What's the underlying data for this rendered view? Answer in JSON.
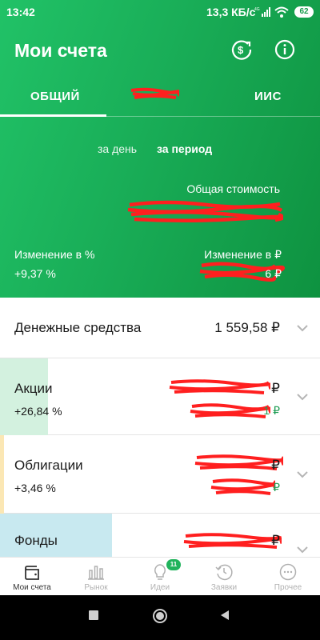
{
  "status": {
    "time": "13:42",
    "speed": "13,3 КБ/с",
    "network": "4G",
    "battery": "62"
  },
  "header": {
    "title": "Мои счета",
    "icons": [
      "currency-exchange-icon",
      "info-icon"
    ]
  },
  "tabs": [
    {
      "label": "ОБЩИЙ",
      "active": true
    },
    {
      "label": "",
      "redacted": true
    },
    {
      "label": "ИИС",
      "active": false
    }
  ],
  "period": {
    "day": "за день",
    "period": "за период",
    "selected": "за период"
  },
  "summary": {
    "total_label": "Общая стоимость",
    "change_pct_label": "Изменение в  %",
    "change_rub_label": "Изменение в ₽",
    "change_pct": "+9,37  %",
    "change_rub_tail": "6 ₽"
  },
  "assets": [
    {
      "name": "Денежные средства",
      "amount": "1 559,58 ₽"
    },
    {
      "name": "Акции",
      "pct": "+26,84  %",
      "amount_tail": "₽",
      "change_tail": "1 ₽",
      "bar_fraction": 0.15,
      "bar_color": "#d3f1df"
    },
    {
      "name": "Облигации",
      "pct": "+3,46  %",
      "amount_tail": "₽",
      "change_tail": "₽",
      "bar_color": "#fbe7b4"
    },
    {
      "name": "Фонды",
      "amount_tail": "₽",
      "bar_color": "#c8e9f0"
    }
  ],
  "bottom_nav": [
    {
      "label": "Мои счета",
      "icon": "wallet-icon",
      "active": true
    },
    {
      "label": "Рынок",
      "icon": "market-chart-icon"
    },
    {
      "label": "Идеи",
      "icon": "lightbulb-icon",
      "badge": "11"
    },
    {
      "label": "Заявки",
      "icon": "history-clock-icon"
    },
    {
      "label": "Прочее",
      "icon": "more-dots-icon"
    }
  ],
  "colors": {
    "brand_green": "#1bb05a",
    "positive_green": "#1f9d55",
    "redaction": "#e8201c"
  }
}
